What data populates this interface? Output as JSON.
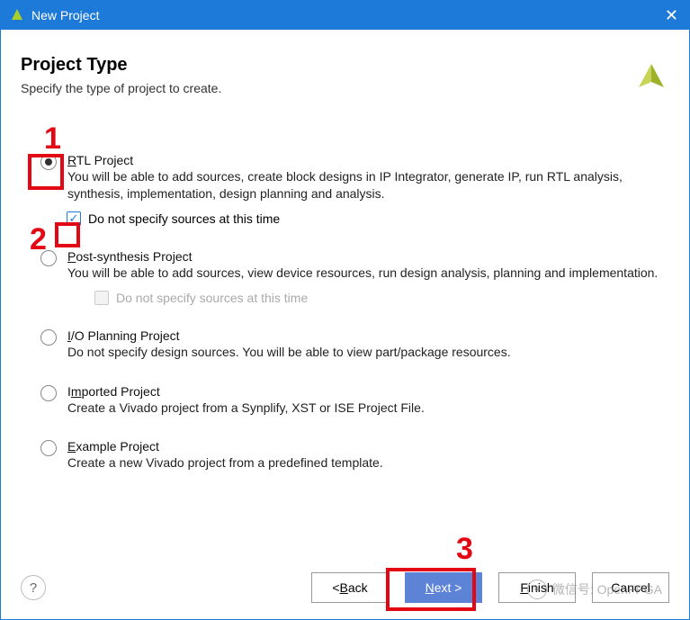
{
  "window": {
    "title": "New Project",
    "close": "✕"
  },
  "header": {
    "title": "Project Type",
    "subtitle": "Specify the type of project to create."
  },
  "options": {
    "rtl": {
      "label_pre": "",
      "label_u": "R",
      "label_post": "TL Project",
      "desc": "You will be able to add sources, create block designs in IP Integrator, generate IP, run RTL analysis, synthesis, implementation, design planning and analysis.",
      "sub_pre": "",
      "sub_u": "D",
      "sub_post": "o not specify sources at this time"
    },
    "post": {
      "label_pre": "",
      "label_u": "P",
      "label_post": "ost-synthesis Project",
      "desc": "You will be able to add sources, view device resources, run design analysis, planning and implementation.",
      "sub_pre": "D",
      "sub_u": "o",
      "sub_post": " not specify sources at this time"
    },
    "io": {
      "label_pre": "",
      "label_u": "I",
      "label_post": "/O Planning Project",
      "desc": "Do not specify design sources. You will be able to view part/package resources."
    },
    "imported": {
      "label_pre": "I",
      "label_u": "m",
      "label_post": "ported Project",
      "desc": "Create a Vivado project from a Synplify, XST or ISE Project File."
    },
    "example": {
      "label_pre": "",
      "label_u": "E",
      "label_post": "xample Project",
      "desc": "Create a new Vivado project from a predefined template."
    }
  },
  "footer": {
    "help": "?",
    "back_pre": "< ",
    "back_u": "B",
    "back_post": "ack",
    "next_u": "N",
    "next_post": "ext >",
    "finish_u": "F",
    "finish_post": "inish",
    "cancel": "Cancel"
  },
  "annotations": {
    "n1": "1",
    "n2": "2",
    "n3": "3"
  },
  "watermark": "微信号: OpenFPGA"
}
